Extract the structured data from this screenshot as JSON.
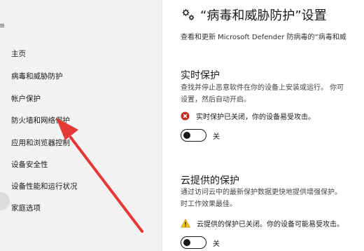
{
  "sidebar": {
    "edge_mark": "≡",
    "items": [
      {
        "label": "主页"
      },
      {
        "label": "病毒和威胁防护"
      },
      {
        "label": "帐户保护"
      },
      {
        "label": "防火墙和网络保护"
      },
      {
        "label": "应用和浏览器控制"
      },
      {
        "label": "设备安全性"
      },
      {
        "label": "设备性能和运行状况"
      },
      {
        "label": "家庭选项"
      }
    ]
  },
  "main": {
    "title": "“病毒和威胁防护”设置",
    "subtitle": "查看和更新 Microsoft Defender 防病毒的“病毒和威",
    "realtime": {
      "title": "实时保护",
      "desc": "查找并停止恶意软件在你的设备上安装或运行。 你可\n设置，然后自动开启。",
      "status": "实时保护已关闭，你的设备易受攻击。",
      "toggle_label": "关"
    },
    "cloud": {
      "title": "云提供的保护",
      "desc": "通过访问云中的最新保护数据更快地提供增强保护。\n时工作效果最佳。",
      "status": "云提供的保护已关闭。你的设备可能易受攻击。",
      "toggle_label": "关"
    }
  },
  "colors": {
    "sidebar_bg": "#f2f2f2",
    "error_red": "#c42b1c",
    "warning_yellow": "#f4c20d",
    "arrow_red": "#e53935"
  },
  "icons": {
    "header": "gear-icon",
    "realtime_status": "error-icon",
    "cloud_status": "warning-icon"
  }
}
